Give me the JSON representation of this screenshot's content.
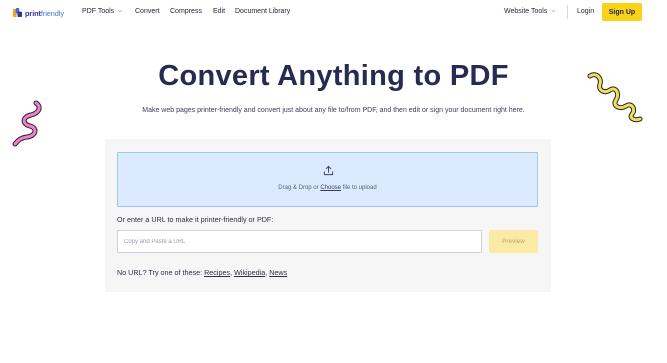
{
  "brand": {
    "name_bold": "print",
    "name_light": "friendly",
    "icon": "printfriendly-logo-icon"
  },
  "nav": {
    "pdf_tools": "PDF Tools",
    "convert": "Convert",
    "compress": "Compress",
    "edit": "Edit",
    "document_library": "Document Library",
    "website_tools": "Website Tools",
    "login": "Login",
    "signup": "Sign Up",
    "dropdown_icon": "chevron-down-icon"
  },
  "hero": {
    "title": "Convert Anything to PDF",
    "subtitle": "Make web pages printer-friendly and convert just about any file to/from PDF, and then edit or sign your document right here."
  },
  "upload": {
    "icon": "upload-icon",
    "text_before": "Drag & Drop or ",
    "choose_link": "Choose",
    "text_after": " file to upload"
  },
  "url_form": {
    "label": "Or enter a URL to make it printer-friendly or PDF:",
    "placeholder": "Copy and Paste a URL",
    "value": "",
    "preview_button": "Preview"
  },
  "suggestions": {
    "prefix": "No URL? Try one of these: ",
    "links": [
      "Recipes",
      "Wikipedia",
      "News"
    ],
    "separator": ", "
  },
  "colors": {
    "accent_yellow": "#f9d21a",
    "title": "#272b52",
    "dropzone_bg": "#dbeafe",
    "dropzone_border": "#9fc6ec",
    "squiggle_pink": "#f47fc2",
    "squiggle_yellow": "#f6e04a",
    "squiggle_outline": "#1e2240"
  }
}
